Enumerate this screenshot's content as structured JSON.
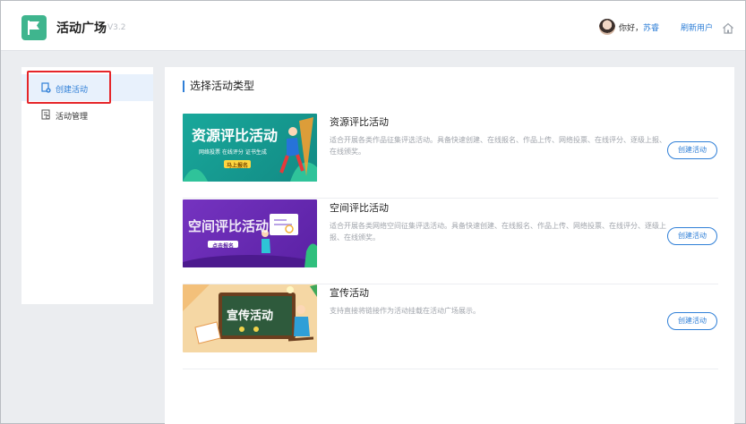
{
  "app": {
    "title": "活动广场",
    "version": "V3.2"
  },
  "user": {
    "greeting": "你好，",
    "name": "苏睿",
    "refresh": "刷新用户"
  },
  "sidebar": {
    "items": [
      {
        "label": "创建活动",
        "icon": "create-activity-icon",
        "active": true
      },
      {
        "label": "活动管理",
        "icon": "activity-manage-icon",
        "active": false
      }
    ]
  },
  "main": {
    "section_title": "选择活动类型",
    "cards": [
      {
        "title": "资源评比活动",
        "description": "适合开展各类作品征集评选活动。具备快速创建、在线报名、作品上传、网络投票、在线评分、逐级上报、在线颁奖。",
        "button": "创建活动",
        "banner": {
          "heading": "资源评比活动",
          "subheading": "网络投票 在线评分 证书生成",
          "badge": "马上报名",
          "bg": "#1aa79a"
        }
      },
      {
        "title": "空间评比活动",
        "description": "适合开展各类网络空间征集评选活动。具备快速创建、在线报名、作品上传、网络投票、在线评分、逐级上报、在线颁奖。",
        "button": "创建活动",
        "banner": {
          "heading": "空间评比活动",
          "badge": "点击报名",
          "bg": "#6a2bb3"
        }
      },
      {
        "title": "宣传活动",
        "description": "支持直接将链接作为活动挂载在活动广场展示。",
        "button": "创建活动",
        "banner": {
          "heading": "宣传活动",
          "bg": "#f6d9a8"
        }
      }
    ]
  },
  "colors": {
    "brand": "#3fb58e",
    "accent": "#2f7fd7",
    "highlight": "#e5262a"
  }
}
